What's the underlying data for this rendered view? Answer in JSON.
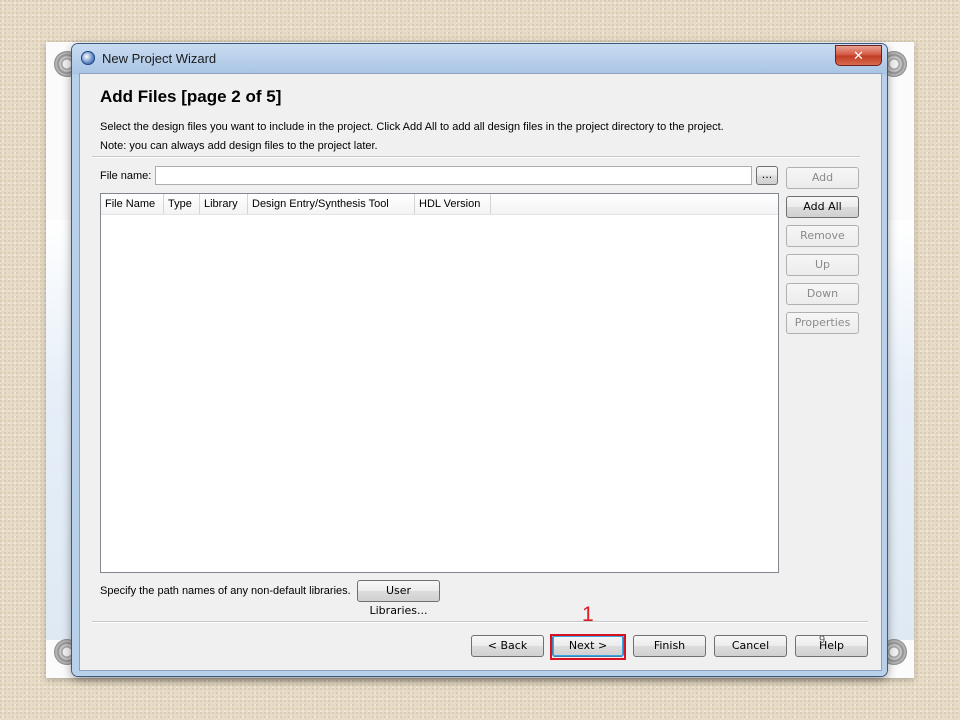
{
  "window": {
    "title": "New Project Wizard",
    "close_label": "✕"
  },
  "page": {
    "heading": "Add Files [page 2 of 5]",
    "instruction_1": "Select the design files you want to include in the project. Click Add All to add all design files in the project directory to the project.",
    "instruction_2": "Note: you can always add design files to the project later."
  },
  "file_name": {
    "label": "File name:",
    "value": "",
    "browse_label": "..."
  },
  "side_buttons": {
    "add": "Add",
    "add_all": "Add All",
    "remove": "Remove",
    "up": "Up",
    "down": "Down",
    "properties": "Properties"
  },
  "table": {
    "columns": [
      "File Name",
      "Type",
      "Library",
      "Design Entry/Synthesis Tool",
      "HDL Version"
    ],
    "rows": []
  },
  "libraries": {
    "text": "Specify the path names of any non-default libraries.",
    "button": "User Libraries..."
  },
  "footer": {
    "back": "< Back",
    "next": "Next >",
    "finish": "Finish",
    "cancel": "Cancel",
    "help": "Help"
  },
  "annotation": {
    "step_number": "1",
    "highlight_color": "#d9121f"
  },
  "slide": {
    "number": "9"
  }
}
